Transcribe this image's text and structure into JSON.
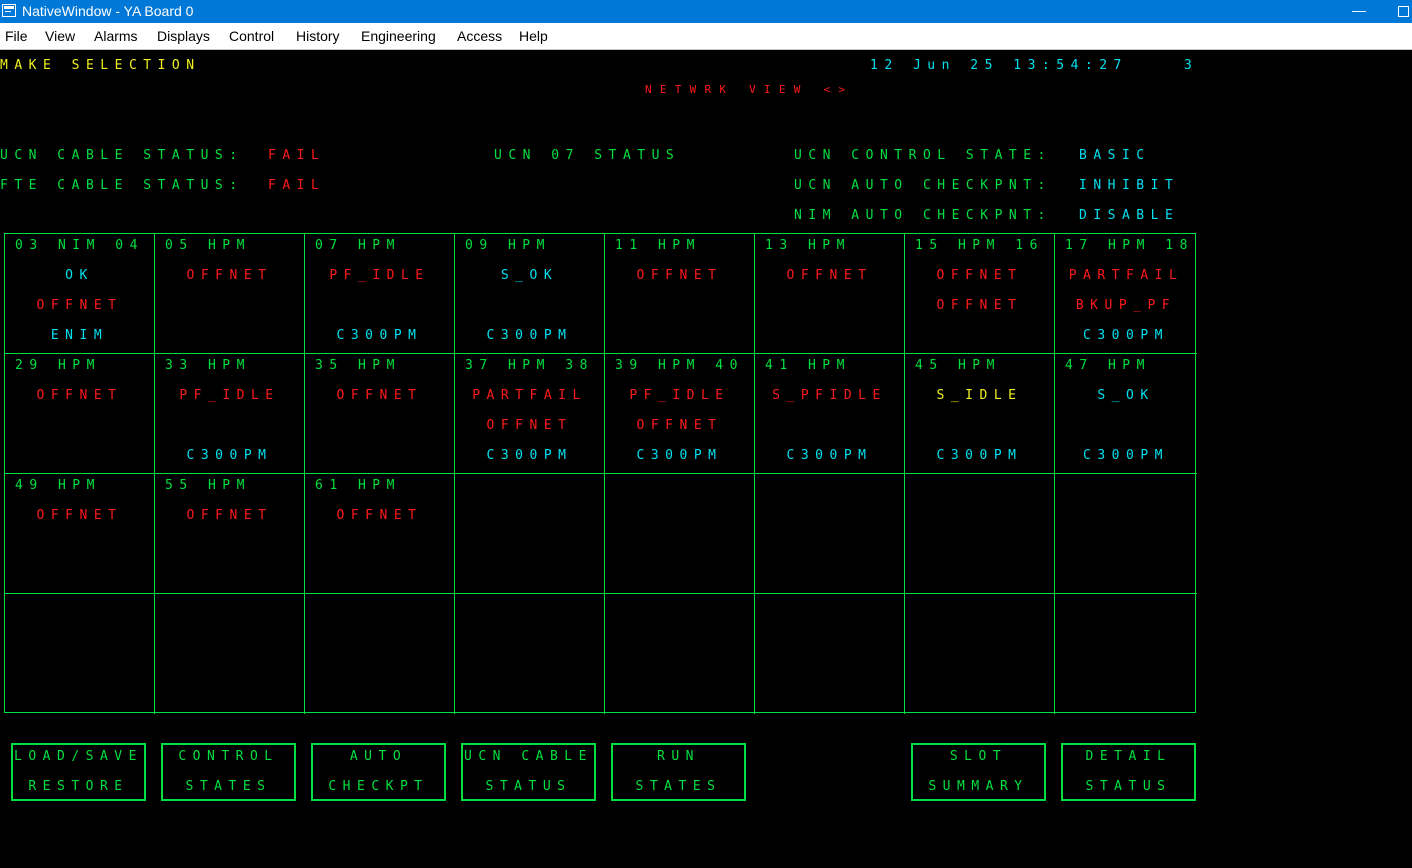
{
  "window": {
    "title": "NativeWindow - YA  Board 0",
    "minimize_glyph": "—"
  },
  "menu": [
    "File",
    "View",
    "Alarms",
    "Displays",
    "Control",
    "History",
    "Engineering",
    "Access",
    "Help"
  ],
  "header": {
    "prompt": "MAKE SELECTION",
    "datetime": "12 Jun 25 13:54:27",
    "console_no": "3",
    "view_title": "NETWRK VIEW <>"
  },
  "status": {
    "ucn_cable_label": "UCN CABLE STATUS:",
    "ucn_cable_value": "FAIL",
    "fte_cable_label": "FTE CABLE STATUS:",
    "fte_cable_value": "FAIL",
    "ucn_title": "UCN 07 STATUS",
    "control_state_label": "UCN CONTROL STATE:",
    "control_state_value": "BASIC",
    "ucn_auto_label": "UCN AUTO CHECKPNT:",
    "ucn_auto_value": "INHIBIT",
    "nim_auto_label": "NIM AUTO CHECKPNT:",
    "nim_auto_value": "DISABLE"
  },
  "nodes": [
    {
      "header": "03 NIM 04",
      "l1": "OK",
      "l1c": "c",
      "l2": "OFFNET",
      "l2c": "r",
      "l3": "ENIM",
      "l3c": "c"
    },
    {
      "header": "05 HPM",
      "l1": "OFFNET",
      "l1c": "r",
      "l2": "",
      "l3": ""
    },
    {
      "header": "07 HPM",
      "l1": "PF_IDLE",
      "l1c": "r",
      "l2": "",
      "l3": "C300PM",
      "l3c": "c"
    },
    {
      "header": "09 HPM",
      "l1": "S_OK",
      "l1c": "c",
      "l2": "",
      "l3": "C300PM",
      "l3c": "c"
    },
    {
      "header": "11 HPM",
      "l1": "OFFNET",
      "l1c": "r",
      "l2": "",
      "l3": ""
    },
    {
      "header": "13 HPM",
      "l1": "OFFNET",
      "l1c": "r",
      "l2": "",
      "l3": ""
    },
    {
      "header": "15 HPM 16",
      "l1": "OFFNET",
      "l1c": "r",
      "l2": "OFFNET",
      "l2c": "r",
      "l3": ""
    },
    {
      "header": "17 HPM 18",
      "l1": "PARTFAIL",
      "l1c": "r",
      "l2": "BKUP_PF",
      "l2c": "r",
      "l3": "C300PM",
      "l3c": "c"
    },
    {
      "header": "29 HPM",
      "l1": "OFFNET",
      "l1c": "r",
      "l2": "",
      "l3": ""
    },
    {
      "header": "33 HPM",
      "l1": "PF_IDLE",
      "l1c": "r",
      "l2": "",
      "l3": "C300PM",
      "l3c": "c"
    },
    {
      "header": "35 HPM",
      "l1": "OFFNET",
      "l1c": "r",
      "l2": "",
      "l3": ""
    },
    {
      "header": "37 HPM 38",
      "l1": "PARTFAIL",
      "l1c": "r",
      "l2": "OFFNET",
      "l2c": "r",
      "l3": "C300PM",
      "l3c": "c"
    },
    {
      "header": "39 HPM 40",
      "l1": "PF_IDLE",
      "l1c": "r",
      "l2": "OFFNET",
      "l2c": "r",
      "l3": "C300PM",
      "l3c": "c"
    },
    {
      "header": "41 HPM",
      "l1": "S_PFIDLE",
      "l1c": "r",
      "l2": "",
      "l3": "C300PM",
      "l3c": "c"
    },
    {
      "header": "45 HPM",
      "l1": "S_IDLE",
      "l1c": "y",
      "l2": "",
      "l3": "C300PM",
      "l3c": "c"
    },
    {
      "header": "47 HPM",
      "l1": "S_OK",
      "l1c": "c",
      "l2": "",
      "l3": "C300PM",
      "l3c": "c"
    },
    {
      "header": "49 HPM",
      "l1": "OFFNET",
      "l1c": "r",
      "l2": "",
      "l3": ""
    },
    {
      "header": "55 HPM",
      "l1": "OFFNET",
      "l1c": "r",
      "l2": "",
      "l3": ""
    },
    {
      "header": "61 HPM",
      "l1": "OFFNET",
      "l1c": "r",
      "l2": "",
      "l3": ""
    },
    {
      "header": "",
      "l1": "",
      "l2": "",
      "l3": ""
    },
    {
      "header": "",
      "l1": "",
      "l2": "",
      "l3": ""
    },
    {
      "header": "",
      "l1": "",
      "l2": "",
      "l3": ""
    },
    {
      "header": "",
      "l1": "",
      "l2": "",
      "l3": ""
    },
    {
      "header": "",
      "l1": "",
      "l2": "",
      "l3": ""
    },
    {
      "header": "",
      "l1": "",
      "l2": "",
      "l3": ""
    },
    {
      "header": "",
      "l1": "",
      "l2": "",
      "l3": ""
    },
    {
      "header": "",
      "l1": "",
      "l2": "",
      "l3": ""
    },
    {
      "header": "",
      "l1": "",
      "l2": "",
      "l3": ""
    },
    {
      "header": "",
      "l1": "",
      "l2": "",
      "l3": ""
    },
    {
      "header": "",
      "l1": "",
      "l2": "",
      "l3": ""
    },
    {
      "header": "",
      "l1": "",
      "l2": "",
      "l3": ""
    },
    {
      "header": "",
      "l1": "",
      "l2": "",
      "l3": ""
    }
  ],
  "buttons": {
    "load_save": [
      "LOAD/SAVE",
      "RESTORE"
    ],
    "control_states": [
      "CONTROL",
      "STATES"
    ],
    "auto_checkpt": [
      "AUTO",
      "CHECKPT"
    ],
    "ucn_cable_status": [
      "UCN CABLE",
      "STATUS"
    ],
    "run_states": [
      "RUN",
      "STATES"
    ],
    "slot_summary": [
      "SLOT",
      "SUMMARY"
    ],
    "detail_status": [
      "DETAIL",
      "STATUS"
    ]
  },
  "colors": {
    "green": "#00e040",
    "red": "#ff1a1a",
    "cyan": "#00e0f0",
    "yellow": "#f0f020",
    "titlebar": "#0078d7"
  }
}
